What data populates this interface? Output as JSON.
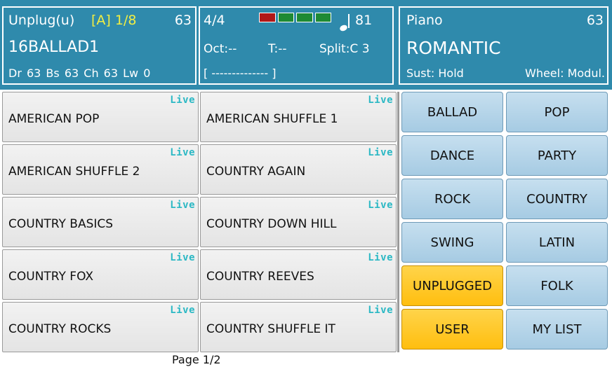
{
  "style_panel": {
    "name": "Unplug(u)",
    "bank": "[A] 1/8",
    "volume": "63",
    "title": "16BALLAD1",
    "levels": "Dr 63  Bs 63  Ch 63  Lw 0"
  },
  "mid_panel": {
    "time_signature": "4/4",
    "meter_colors": [
      "#b01818",
      "#1e8a34",
      "#1e8a34",
      "#1e8a34"
    ],
    "tempo": "81",
    "octave": "Oct:--",
    "transpose": "T:--",
    "split": "Split:C 3",
    "bracket": "[ -------------- ]"
  },
  "voice_panel": {
    "category": "Piano",
    "volume": "63",
    "name": "ROMANTIC",
    "sustain": "Sust: Hold",
    "wheel": "Wheel: Modul."
  },
  "styles": [
    {
      "name": "AMERICAN POP",
      "tag": "Live"
    },
    {
      "name": "AMERICAN SHUFFLE 1",
      "tag": "Live"
    },
    {
      "name": "AMERICAN SHUFFLE 2",
      "tag": "Live"
    },
    {
      "name": "COUNTRY AGAIN",
      "tag": "Live"
    },
    {
      "name": "COUNTRY BASICS",
      "tag": "Live"
    },
    {
      "name": "COUNTRY DOWN HILL",
      "tag": "Live"
    },
    {
      "name": "COUNTRY FOX",
      "tag": "Live"
    },
    {
      "name": "COUNTRY REEVES",
      "tag": "Live"
    },
    {
      "name": "COUNTRY ROCKS",
      "tag": "Live"
    },
    {
      "name": "COUNTRY SHUFFLE IT",
      "tag": "Live"
    }
  ],
  "categories": [
    {
      "label": "BALLAD",
      "active": false
    },
    {
      "label": "POP",
      "active": false
    },
    {
      "label": "DANCE",
      "active": false
    },
    {
      "label": "PARTY",
      "active": false
    },
    {
      "label": "ROCK",
      "active": false
    },
    {
      "label": "COUNTRY",
      "active": false
    },
    {
      "label": "SWING",
      "active": false
    },
    {
      "label": "LATIN",
      "active": false
    },
    {
      "label": "UNPLUGGED",
      "active": true
    },
    {
      "label": "FOLK",
      "active": false
    },
    {
      "label": "USER",
      "active": true
    },
    {
      "label": "MY LIST",
      "active": false
    }
  ],
  "page": "Page 1/2"
}
